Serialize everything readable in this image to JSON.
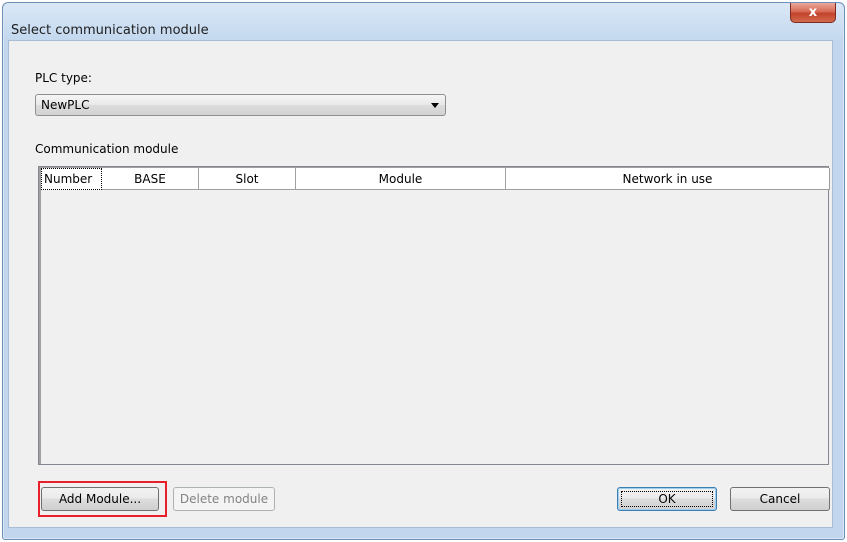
{
  "window": {
    "title": "Select communication module",
    "close_glyph": "x"
  },
  "plc_type": {
    "label": "PLC type:",
    "selected_value": "NewPLC"
  },
  "comm_module": {
    "label": "Communication module",
    "columns": [
      "Number",
      "BASE",
      "Slot",
      "Module",
      "Network in use"
    ],
    "rows": []
  },
  "buttons": {
    "add_module": "Add Module...",
    "delete_module": "Delete module",
    "ok": "OK",
    "cancel": "Cancel"
  },
  "colors": {
    "highlight": "#e8202a",
    "close_button": "#c2432c"
  }
}
